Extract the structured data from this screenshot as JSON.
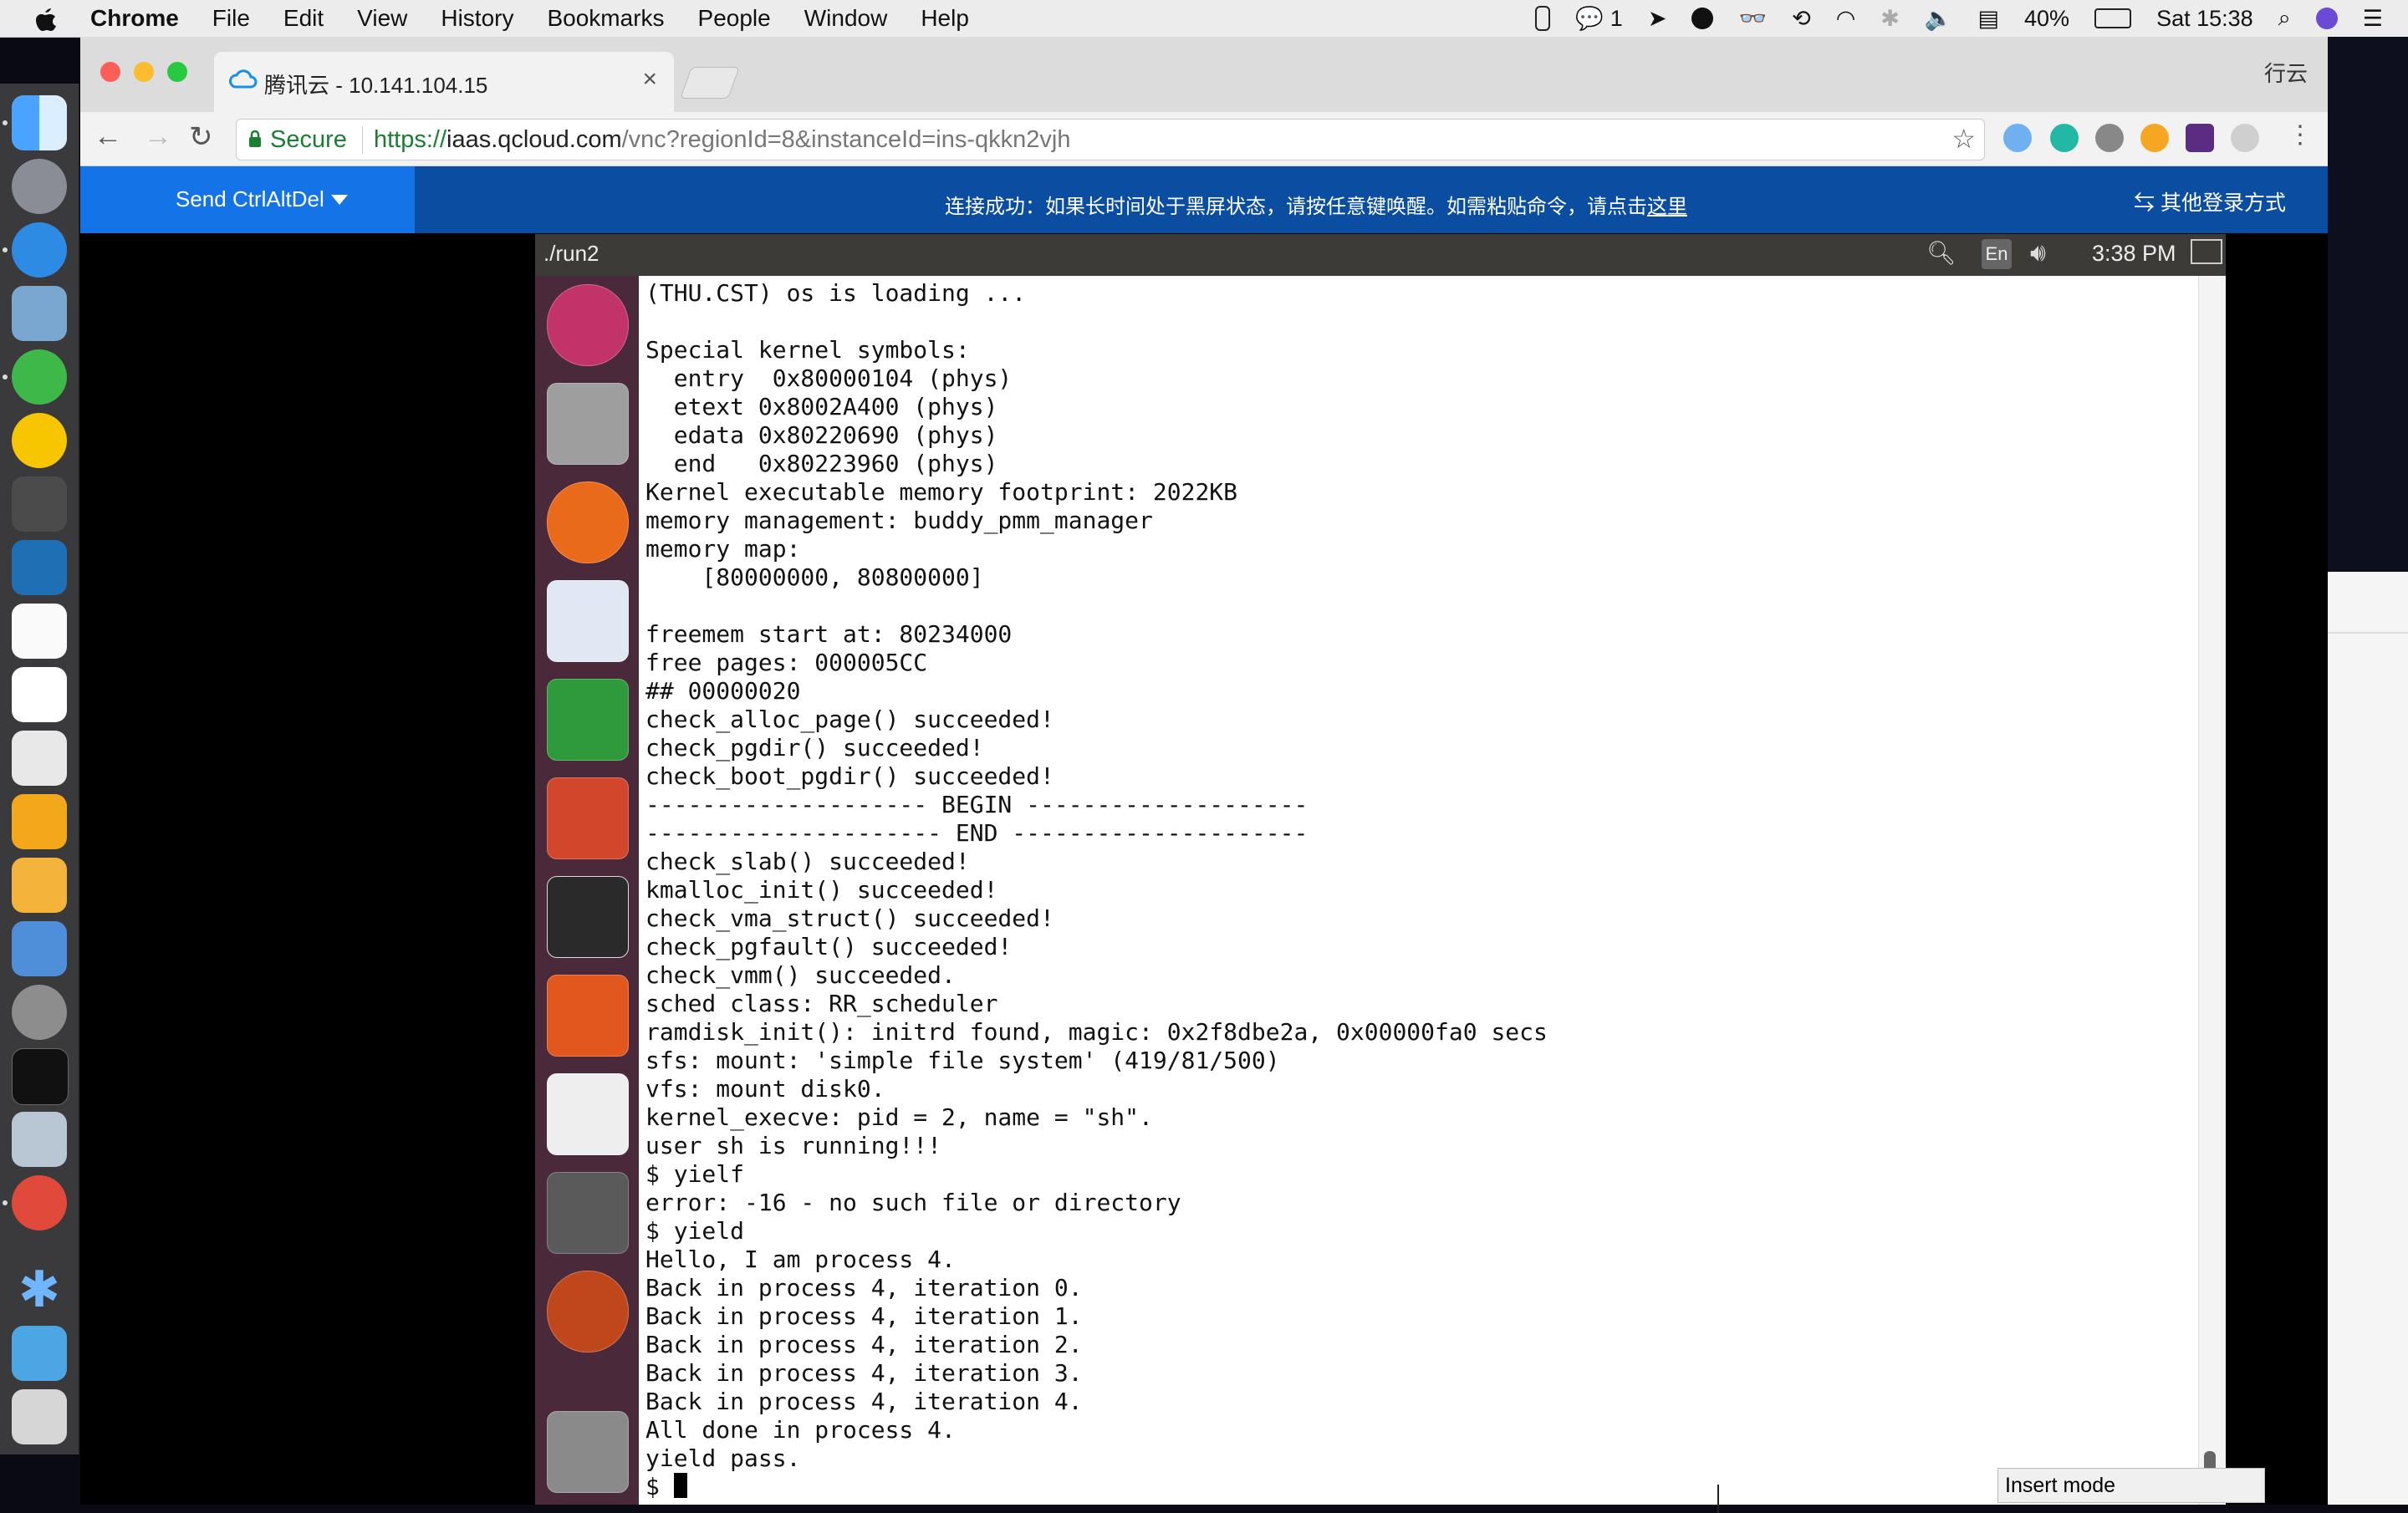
{
  "menubar": {
    "app": "Chrome",
    "items": [
      "File",
      "Edit",
      "View",
      "History",
      "Bookmarks",
      "People",
      "Window",
      "Help"
    ],
    "wechat_count": "1",
    "battery": "40%",
    "clock": "Sat 15:38"
  },
  "browser": {
    "tab_title": "腾讯云 - 10.141.104.15",
    "profile": "行云",
    "secure_label": "Secure",
    "url_scheme": "https://",
    "url_host": "iaas.qcloud.com",
    "url_path": "/vnc?regionId=8&instanceId=ins-qkkn2vjh"
  },
  "vnc_bar": {
    "ctrl_alt_del": "Send CtrlAltDel",
    "notice": "连接成功：如果长时间处于黑屏状态，请按任意键唤醒。如需粘贴命令，请点击",
    "notice_link": "这里",
    "other_login": "其他登录方式"
  },
  "vnc": {
    "window_title": "./run2",
    "lang": "En",
    "clock": "3:38 PM",
    "terminal_lines": [
      "(THU.CST) os is loading ...",
      "",
      "Special kernel symbols:",
      "  entry  0x80000104 (phys)",
      "  etext 0x8002A400 (phys)",
      "  edata 0x80220690 (phys)",
      "  end   0x80223960 (phys)",
      "Kernel executable memory footprint: 2022KB",
      "memory management: buddy_pmm_manager",
      "memory map:",
      "    [80000000, 80800000]",
      "",
      "freemem start at: 80234000",
      "free pages: 000005CC",
      "## 00000020",
      "check_alloc_page() succeeded!",
      "check_pgdir() succeeded!",
      "check_boot_pgdir() succeeded!",
      "-------------------- BEGIN --------------------",
      "--------------------- END ---------------------",
      "check_slab() succeeded!",
      "kmalloc_init() succeeded!",
      "check_vma_struct() succeeded!",
      "check_pgfault() succeeded!",
      "check_vmm() succeeded.",
      "sched class: RR_scheduler",
      "ramdisk_init(): initrd found, magic: 0x2f8dbe2a, 0x00000fa0 secs",
      "sfs: mount: 'simple file system' (419/81/500)",
      "vfs: mount disk0.",
      "kernel_execve: pid = 2, name = \"sh\".",
      "user sh is running!!!",
      "$ yielf",
      "error: -16 - no such file or directory",
      "$ yield",
      "Hello, I am process 4.",
      "Back in process 4, iteration 0.",
      "Back in process 4, iteration 1.",
      "Back in process 4, iteration 2.",
      "Back in process 4, iteration 3.",
      "Back in process 4, iteration 4.",
      "All done in process 4.",
      "yield pass."
    ],
    "prompt": "$ ",
    "insert_mode": "Insert mode"
  },
  "colors": {
    "vnc_bar": "#0a4da1",
    "ctrl_alt_del_bg": "#1473e6",
    "launcher": "#4a2a3a",
    "secure_green": "#1a7f33"
  }
}
